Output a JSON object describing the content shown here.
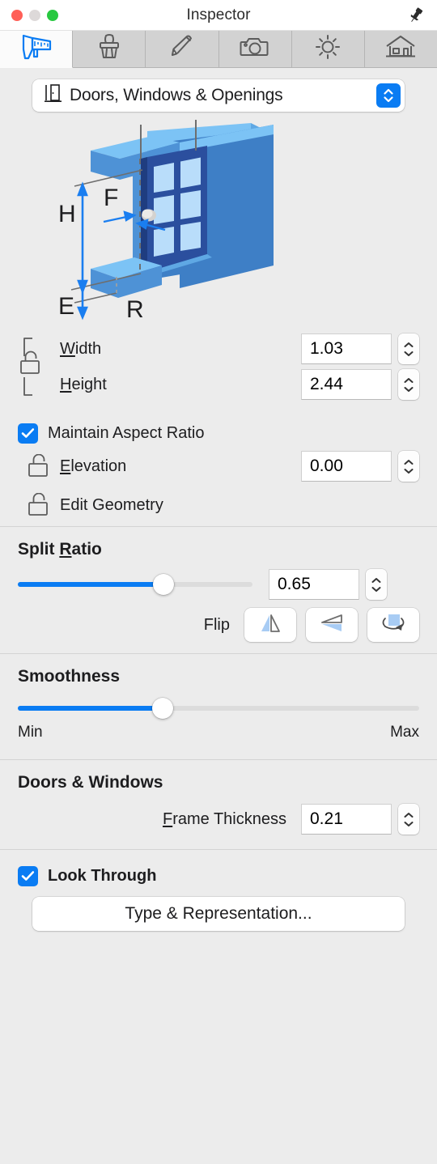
{
  "window": {
    "title": "Inspector",
    "traffic_lights": [
      "close",
      "minimize",
      "zoom"
    ],
    "pin_icon": "pin-icon"
  },
  "tabs": [
    {
      "name": "measure",
      "icon": "caliper-icon",
      "active": true
    },
    {
      "name": "materials",
      "icon": "paintbrush-icon",
      "active": false
    },
    {
      "name": "edit",
      "icon": "pencil-icon",
      "active": false
    },
    {
      "name": "camera",
      "icon": "camera-icon",
      "active": false
    },
    {
      "name": "light",
      "icon": "sun-icon",
      "active": false
    },
    {
      "name": "site",
      "icon": "house-icon",
      "active": false
    }
  ],
  "category_popup": {
    "value": "Doors, Windows & Openings",
    "icon": "door-icon",
    "stepper_icon": "chevron-up-down-icon"
  },
  "illustration": {
    "name": "window-dimension-diagram",
    "labels": [
      "H",
      "E",
      "F",
      "R"
    ],
    "colors": {
      "wall_face": "#3e7fc6",
      "wall_top": "#7cc3f5",
      "wall_side": "#4e92d6",
      "frame": "#2b4f9e",
      "frame_edge": "#1f3d80",
      "glass": "#b9ddfa",
      "arrow": "#1a7ef0",
      "leader": "#6e6e6e",
      "handle": "#d4d2cf"
    },
    "panes": {
      "columns": 2,
      "rows": 3
    }
  },
  "dimensions": {
    "lock_icon": "unlocked-padlock-icon",
    "width": {
      "label": "Width",
      "mnemonic": "W",
      "value": "1.03"
    },
    "height": {
      "label": "Height",
      "mnemonic": "H",
      "value": "2.44"
    },
    "maintain_aspect_ratio": {
      "label": "Maintain Aspect Ratio",
      "checked": true
    },
    "elevation": {
      "label": "Elevation",
      "mnemonic": "E",
      "value": "0.00",
      "lock_icon": "unlocked-padlock-icon"
    },
    "edit_geometry": {
      "label": "Edit Geometry",
      "lock_icon": "unlocked-padlock-icon"
    }
  },
  "split_ratio": {
    "heading": "Split Ratio",
    "mnemonic": "R",
    "value": "0.65",
    "slider_percent": 62,
    "flip": {
      "label": "Flip",
      "buttons": [
        {
          "name": "flip-horizontal-button",
          "icon": "mirror-horizontal-icon"
        },
        {
          "name": "flip-vertical-button",
          "icon": "mirror-vertical-icon"
        },
        {
          "name": "flip-depth-button",
          "icon": "rotate-reverse-icon"
        }
      ]
    }
  },
  "smoothness": {
    "heading": "Smoothness",
    "slider_percent": 36,
    "min_label": "Min",
    "max_label": "Max"
  },
  "doors_windows": {
    "heading": "Doors & Windows",
    "frame_thickness": {
      "label": "Frame Thickness",
      "mnemonic": "F",
      "value": "0.21"
    }
  },
  "look_through": {
    "label": "Look Through",
    "checked": true
  },
  "type_representation_button": {
    "label": "Type & Representation..."
  },
  "theme": {
    "accent": "#0a7cf3",
    "background": "#ececec",
    "tab_inactive": "#d2d2d2",
    "tab_active": "#fbfbfb",
    "divider": "#d3d3d3"
  }
}
